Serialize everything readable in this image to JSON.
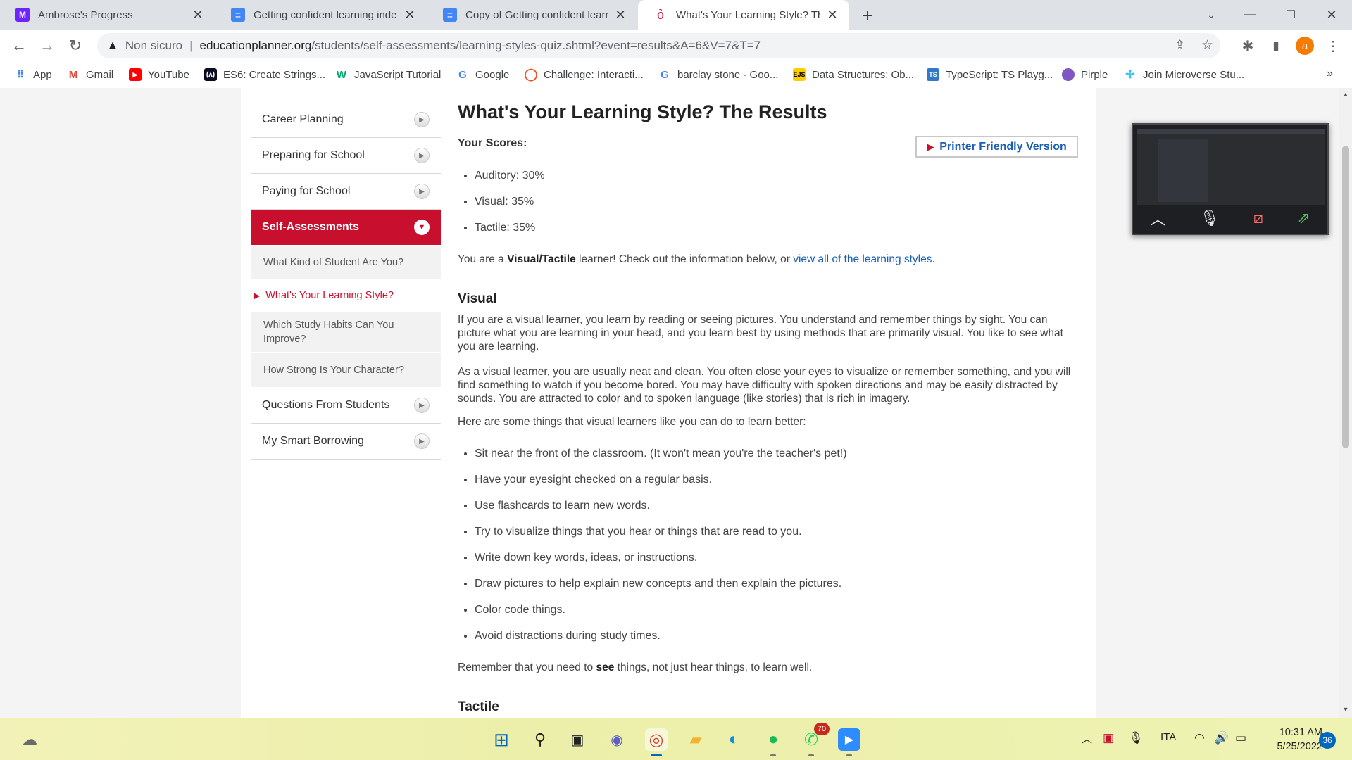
{
  "browser": {
    "tabs": [
      {
        "title": "Ambrose's Progress",
        "icon": "microverse-logo-icon",
        "color": "#6f23ff"
      },
      {
        "title": "Getting confident learning indep",
        "icon": "google-docs-icon",
        "color": "#4285f4"
      },
      {
        "title": "Copy of Getting confident learnin",
        "icon": "google-docs-icon",
        "color": "#4285f4"
      },
      {
        "title": "What's Your Learning Style? The R",
        "icon": "apple-icon",
        "color": "#c8102e"
      }
    ],
    "address": {
      "warning": "Non sicuro",
      "host": "educationplanner.org",
      "path": "/students/self-assessments/learning-styles-quiz.shtml?event=results&A=6&V=7&T=7"
    },
    "profile_initial": "a",
    "bookmarks": [
      {
        "label": "App",
        "icon": "apps-grid-icon",
        "color": "#4285f4"
      },
      {
        "label": "Gmail",
        "icon": "gmail-icon",
        "color": "#ea4335"
      },
      {
        "label": "YouTube",
        "icon": "youtube-icon",
        "color": "#ff0000"
      },
      {
        "label": "ES6: Create Strings...",
        "icon": "freecodecamp-icon",
        "color": "#0a0a23"
      },
      {
        "label": "JavaScript Tutorial",
        "icon": "w3schools-icon",
        "color": "#04aa6d"
      },
      {
        "label": "Google",
        "icon": "google-icon",
        "color": "#4285f4"
      },
      {
        "label": "Challenge: Interacti...",
        "icon": "khan-circle-icon",
        "color": "#f4511e"
      },
      {
        "label": "barclay stone - Goo...",
        "icon": "google-icon",
        "color": "#4285f4"
      },
      {
        "label": "Data Structures: Ob...",
        "icon": "ejs-icon",
        "color": "#ffcc00"
      },
      {
        "label": "TypeScript: TS Playg...",
        "icon": "typescript-icon",
        "color": "#3178c6"
      },
      {
        "label": "Pirple",
        "icon": "pirple-icon",
        "color": "#7e57c2"
      },
      {
        "label": "Join Microverse Stu...",
        "icon": "slack-icon",
        "color": "#36c5f0"
      }
    ]
  },
  "sidebar": {
    "items_top": [
      "Career Planning",
      "Preparing for School",
      "Paying for School"
    ],
    "active": "Self-Assessments",
    "sub_items": [
      "What Kind of Student Are You?",
      "What's Your Learning Style?",
      "Which Study Habits Can You Improve?",
      "How Strong Is Your Character?"
    ],
    "items_bottom": [
      "Questions From Students",
      "My Smart Borrowing"
    ]
  },
  "main": {
    "title": "What's Your Learning Style? The Results",
    "scores_label": "Your Scores:",
    "printer_button": "Printer Friendly Version",
    "scores": [
      "Auditory: 30%",
      "Visual: 35%",
      "Tactile: 35%"
    ],
    "result_pre": "You are a ",
    "result_type": "Visual/Tactile",
    "result_mid": " learner! Check out the information below, or ",
    "result_link": "view all of the learning styles",
    "result_end": ".",
    "visual_heading": "Visual",
    "visual_p1": "If you are a visual learner, you learn by reading or seeing pictures. You understand and remember things by sight. You can picture what you are learning in your head, and you learn best by using methods that are primarily visual. You like to see what you are learning.",
    "visual_p2": "As a visual learner, you are usually neat and clean. You often close your eyes to visualize or remember something, and you will find something to watch if you become bored. You may have difficulty with spoken directions and may be easily distracted by sounds. You are attracted to color and to spoken language (like stories) that is rich in imagery.",
    "visual_intro": "Here are some things that visual learners like you can do to learn better:",
    "visual_tips": [
      "Sit near the front of the classroom. (It won't mean you're the teacher's pet!)",
      "Have your eyesight checked on a regular basis.",
      "Use flashcards to learn new words.",
      "Try to visualize things that you hear or things that are read to you.",
      "Write down key words, ideas, or instructions.",
      "Draw pictures to help explain new concepts and then explain the pictures.",
      "Color code things.",
      "Avoid distractions during study times."
    ],
    "remember_pre": "Remember that you need to ",
    "remember_bold": "see",
    "remember_end": " things, not just hear things, to learn well.",
    "tactile_heading": "Tactile"
  },
  "taskbar": {
    "whatsapp_badge": "70",
    "language": "ITA",
    "time": "10:31 AM",
    "date": "5/25/2022",
    "notifications": "36"
  },
  "colors": {
    "accent_red": "#c8102e",
    "link_blue": "#1a5fb4"
  }
}
